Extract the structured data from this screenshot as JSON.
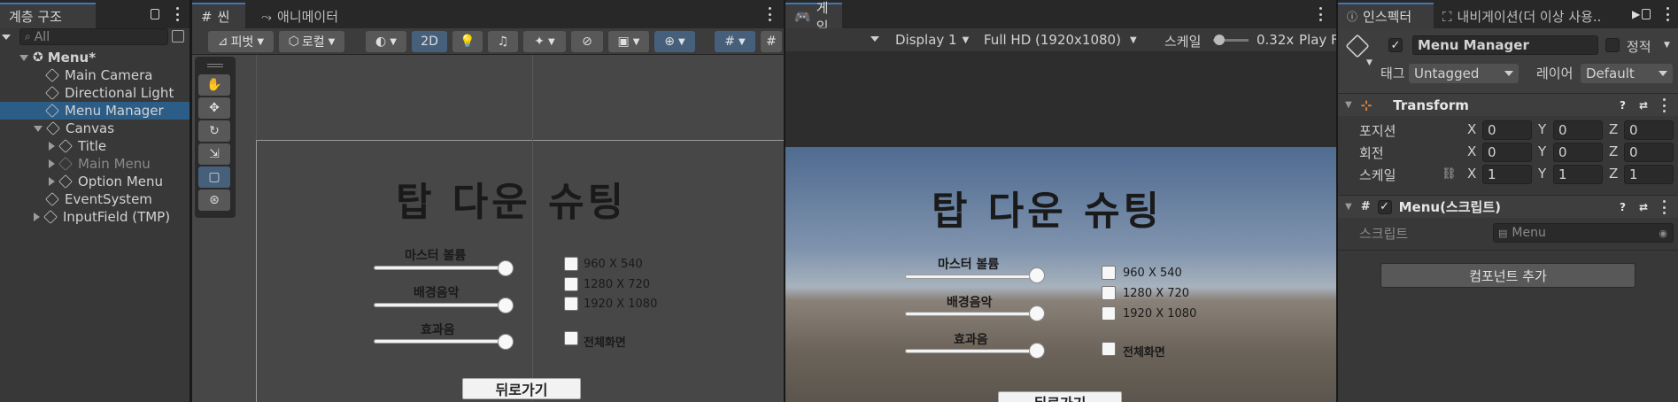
{
  "hierarchy": {
    "tab_label": "계층 구조",
    "search_placeholder": "All",
    "items": [
      {
        "label": "Menu*",
        "depth": 0
      },
      {
        "label": "Main Camera",
        "depth": 1
      },
      {
        "label": "Directional Light",
        "depth": 1
      },
      {
        "label": "Menu Manager",
        "depth": 1,
        "selected": true
      },
      {
        "label": "Canvas",
        "depth": 1
      },
      {
        "label": "Title",
        "depth": 2
      },
      {
        "label": "Main Menu",
        "depth": 2,
        "dim": true
      },
      {
        "label": "Option Menu",
        "depth": 2
      },
      {
        "label": "EventSystem",
        "depth": 1
      },
      {
        "label": "InputField (TMP)",
        "depth": 1
      }
    ]
  },
  "scene": {
    "tab_scene": "씬",
    "tab_animator": "애니메이터",
    "pivot_label": "피벗",
    "local_label": "로컬",
    "mode_2d": "2D"
  },
  "game_ui": {
    "title": "탑 다운 슈팅",
    "sliders": [
      {
        "label": "마스터 볼륨",
        "value": 1.0
      },
      {
        "label": "배경음악",
        "value": 1.0
      },
      {
        "label": "효과음",
        "value": 1.0
      }
    ],
    "resolutions": [
      "960 X 540",
      "1280 X 720",
      "1920 X 1080"
    ],
    "fullscreen_label": "전체화면",
    "back_button": "뒤로가기"
  },
  "game": {
    "tab_label": "게임",
    "display": "Display 1",
    "resolution": "Full HD (1920x1080)",
    "scale_label": "스케일",
    "scale_value": "0.32x",
    "play_label": "Play F"
  },
  "inspector": {
    "tab_label": "인스펙터",
    "tab_nav": "내비게이션(더 이상 사용..",
    "object_name": "Menu Manager",
    "static_label": "정적",
    "tag_label": "태그",
    "tag_value": "Untagged",
    "layer_label": "레이어",
    "layer_value": "Default",
    "transform": {
      "title": "Transform",
      "position_label": "포지션",
      "rotation_label": "회전",
      "scale_label": "스케일",
      "position": [
        "0",
        "0",
        "0"
      ],
      "rotation": [
        "0",
        "0",
        "0"
      ],
      "scale": [
        "1",
        "1",
        "1"
      ]
    },
    "script_component": {
      "title": "Menu(스크립트)",
      "script_label": "스크립트",
      "script_value": "Menu"
    },
    "add_component": "컴포넌트 추가"
  },
  "colors": {
    "selection": "#2c5d87",
    "active_tab_accent": "#3a79bb",
    "sky_top": "#5a7396",
    "ground": "#6e655b"
  }
}
